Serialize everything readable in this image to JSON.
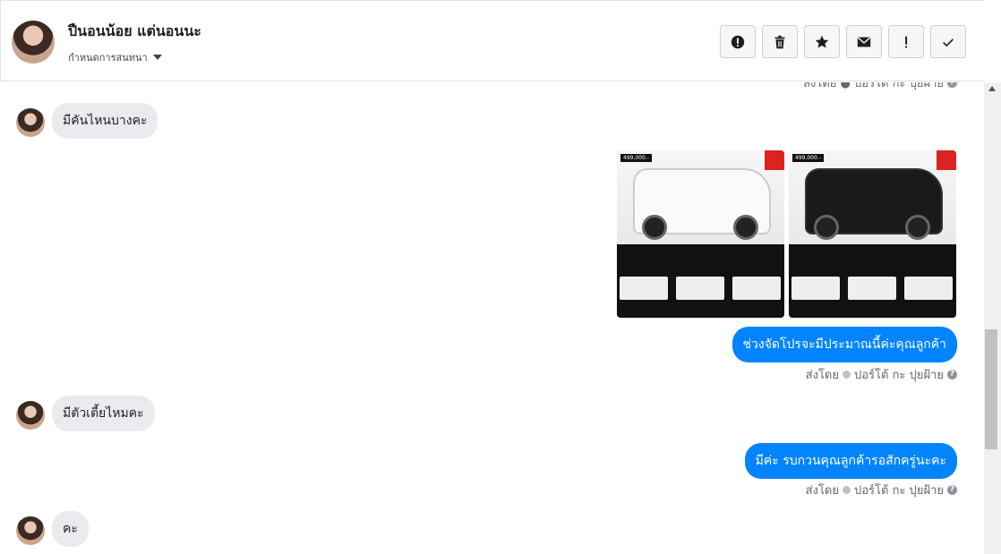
{
  "header": {
    "name": "ปืนอนน้อย แต่นอนนะ",
    "subtitle": "กำหนดการสนทนา"
  },
  "toolbar": {
    "buttons": [
      "alert-circle-icon",
      "trash-icon",
      "star-icon",
      "envelope-icon",
      "exclamation-icon",
      "check-icon"
    ]
  },
  "thread": {
    "top_sent_partial": "ส่งโดย ● ปอร์โต้ กะ ปุยฝ้าย",
    "messages": [
      {
        "from": "customer",
        "text": "มีคันไหนบางคะ"
      },
      {
        "from": "page",
        "text": "ช่วงจัดโปรจะมีประมาณนี้ค่ะคุณลูกค้า",
        "sent_by": "ส่งโดย",
        "sender": "ปอร์โต้ กะ ปุยฝ้าย"
      },
      {
        "from": "customer",
        "text": "มีตัวเตี้ยไหมคะ"
      },
      {
        "from": "page",
        "text": "มีค่ะ รบกวนคุณลูกค้ารอสักครู่นะคะ",
        "sent_by": "ส่งโดย",
        "sender": "ปอร์โต้ กะ ปุยฝ้าย"
      },
      {
        "from": "customer",
        "text": "คะ"
      }
    ],
    "photos": [
      {
        "name": "white-pickup-photo",
        "price": "499,000.-",
        "color": "#ffffff"
      },
      {
        "name": "black-pickup-photo",
        "price": "499,000.-",
        "color": "#1a1a1a"
      }
    ]
  },
  "colors": {
    "accent": "#0084ff",
    "incoming": "#e9ebee"
  }
}
